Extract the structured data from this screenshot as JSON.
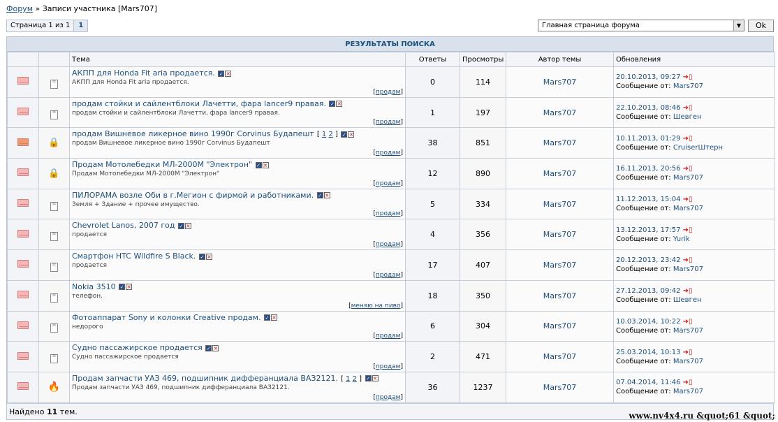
{
  "breadcrumb": {
    "forum": "Форум",
    "sep": "»",
    "current": "Записи участника [Mars707]"
  },
  "pager": {
    "text": "Страница 1 из 1",
    "page": "1"
  },
  "jump": {
    "selected": "Главная страница форума",
    "ok": "Ok"
  },
  "results": {
    "title": "РЕЗУЛЬТАТЫ ПОИСКА",
    "columns": {
      "topic": "Тема",
      "replies": "Ответы",
      "views": "Просмотры",
      "author": "Автор темы",
      "updates": "Обновления"
    },
    "footer_prefix": "Найдено",
    "footer_count": "11",
    "footer_suffix": "тем.",
    "msg_from": "Сообщение от:"
  },
  "rows": [
    {
      "icon": "envelope-icon",
      "status": "doc",
      "title": "АКПП для Honda Fit aria продается.",
      "desc": "АКПП для Honda Fit aria продается.",
      "tag": "продам",
      "replies": "0",
      "views": "114",
      "author": "Mars707",
      "date": "20.10.2013, 09:27",
      "by": "Mars707"
    },
    {
      "icon": "envelope-icon",
      "status": "doc",
      "title": "продам стойки и сайлентблоки Лачетти, фара lancer9 правая.",
      "desc": "продам стойки и сайлентблоки Лачетти, фара lancer9 правая.",
      "tag": "продам",
      "replies": "1",
      "views": "197",
      "author": "Mars707",
      "date": "22.10.2013, 08:46",
      "by": "Шевген"
    },
    {
      "icon": "envelope-hot-icon",
      "status": "lock",
      "title": "продам Вишневое ликерное вино 1990г Corvinus Будапешт",
      "pages": [
        "1",
        "2"
      ],
      "desc": "продам Вишневое ликерное вино 1990г Corvinus Будапешт",
      "tag": "продам",
      "replies": "38",
      "views": "851",
      "author": "Mars707",
      "date": "10.11.2013, 01:29",
      "by": "CruiserШтерн"
    },
    {
      "icon": "envelope-icon",
      "status": "lock",
      "title": "Продам Мотолебедки МЛ-2000М \"Электрон\"",
      "desc": "Продам Мотолебедки МЛ-2000М \"Электрон\"",
      "tag": "продам",
      "replies": "12",
      "views": "890",
      "author": "Mars707",
      "date": "16.11.2013, 20:56",
      "by": "Mars707"
    },
    {
      "icon": "envelope-icon",
      "status": "doc",
      "title": "ПИЛОРАМА возле Оби в г.Мегион с фирмой и работниками.",
      "desc": "Земля + Здание + прочее имущество.",
      "tag": "продам",
      "replies": "5",
      "views": "334",
      "author": "Mars707",
      "date": "11.12.2013, 15:04",
      "by": "Mars707"
    },
    {
      "icon": "envelope-icon",
      "status": "doc",
      "title": "Chevrolet Lanos, 2007 год",
      "desc": "продается",
      "tag": "продам",
      "replies": "4",
      "views": "356",
      "author": "Mars707",
      "date": "13.12.2013, 17:57",
      "by": "Yurik"
    },
    {
      "icon": "envelope-icon",
      "status": "doc",
      "title": "Смартфон HTC Wildfire S Black.",
      "desc": "продается",
      "tag": "продам",
      "replies": "17",
      "views": "407",
      "author": "Mars707",
      "date": "20.12.2013, 23:42",
      "by": "Mars707"
    },
    {
      "icon": "envelope-icon",
      "status": "doc",
      "title": "Nokia 3510",
      "desc": "телефон.",
      "tag": "меняю на пиво",
      "replies": "18",
      "views": "350",
      "author": "Mars707",
      "date": "27.12.2013, 09:42",
      "by": "Шевген"
    },
    {
      "icon": "envelope-icon",
      "status": "doc",
      "title": "Фотоаппарат Sony и колонки Creative продам.",
      "desc": "недорого",
      "tag": "продам",
      "replies": "6",
      "views": "304",
      "author": "Mars707",
      "date": "10.03.2014, 10:22",
      "by": "Mars707"
    },
    {
      "icon": "envelope-icon",
      "status": "doc",
      "title": "Судно пассажирское продается",
      "desc": "Судно пассажирское продается",
      "tag": "продам",
      "replies": "2",
      "views": "471",
      "author": "Mars707",
      "date": "25.03.2014, 10:13",
      "by": "Mars707"
    },
    {
      "icon": "envelope-icon",
      "status": "fire",
      "title": "Продам запчасти УАЗ 469, подшипник дифферанциала ВАЗ2121.",
      "pages": [
        "1",
        "2"
      ],
      "desc": "Продам запчасти УАЗ 469, подшипник дифферанциала ВАЗ2121.",
      "tag": "продам",
      "replies": "36",
      "views": "1237",
      "author": "Mars707",
      "date": "07.04.2014, 11:46",
      "by": "Mars707"
    }
  ],
  "watermark": "www.nv4x4.ru &quot;61 &quot;"
}
